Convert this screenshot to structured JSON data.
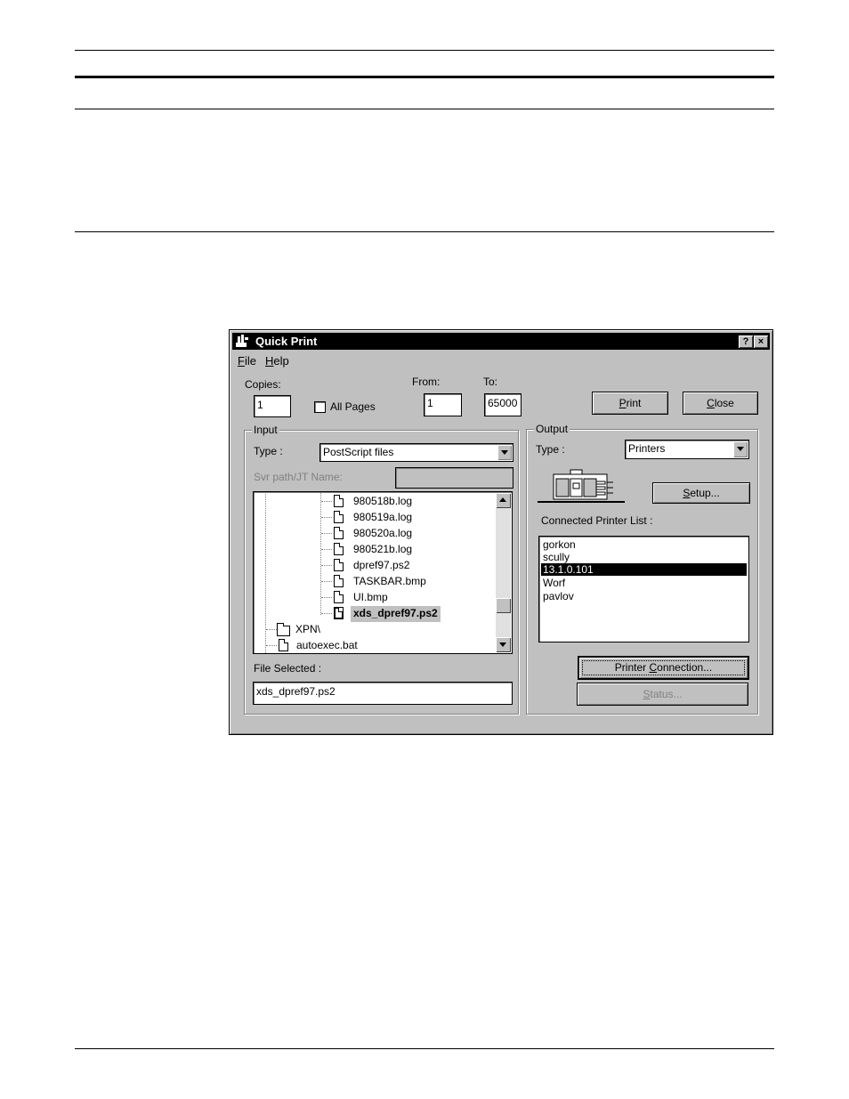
{
  "window": {
    "title": "Quick Print",
    "help_button": "?",
    "close_button": "×"
  },
  "menu": {
    "file": "File",
    "file_key": "F",
    "help": "Help",
    "help_key": "H"
  },
  "copies": {
    "label": "Copies:",
    "value": "1"
  },
  "all_pages": {
    "label": "All Pages",
    "checked": false
  },
  "range": {
    "from_label": "From:",
    "from_value": "1",
    "to_label": "To:",
    "to_value": "65000"
  },
  "buttons": {
    "print": "Print",
    "close": "Close",
    "setup": "Setup...",
    "printer_connection": "Printer Connection...",
    "status": "Status..."
  },
  "input": {
    "group_label": "Input",
    "type_label": "Type :",
    "type_value": "PostScript files",
    "svr_label": "Svr path/JT Name:",
    "svr_value": "",
    "files": [
      {
        "name": "980518b.log",
        "kind": "file"
      },
      {
        "name": "980519a.log",
        "kind": "file"
      },
      {
        "name": "980520a.log",
        "kind": "file"
      },
      {
        "name": "980521b.log",
        "kind": "file"
      },
      {
        "name": "dpref97.ps2",
        "kind": "file"
      },
      {
        "name": "TASKBAR.bmp",
        "kind": "file"
      },
      {
        "name": "UI.bmp",
        "kind": "file"
      },
      {
        "name": "xds_dpref97.ps2",
        "kind": "file",
        "selected": true
      },
      {
        "name": "XPN\\",
        "kind": "folder"
      },
      {
        "name": "autoexec.bat",
        "kind": "file"
      }
    ],
    "file_selected_label": "File Selected :",
    "file_selected_value": "xds_dpref97.ps2"
  },
  "output": {
    "group_label": "Output",
    "type_label": "Type :",
    "type_value": "Printers",
    "printer_icon": "printer-icon",
    "list_label": "Connected Printer List :",
    "printers": [
      "gorkon",
      "scully",
      "13.1.0.101",
      "Worf",
      "pavlov"
    ],
    "selected_printer": "13.1.0.101"
  }
}
